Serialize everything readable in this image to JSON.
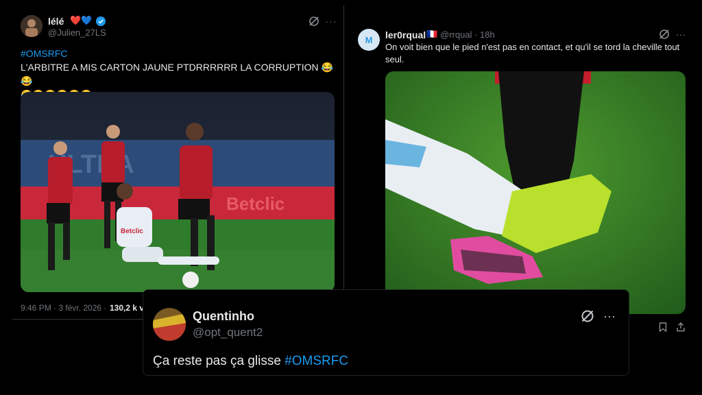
{
  "tweet1": {
    "name": "lélé",
    "handle": "@Julien_27LS",
    "hashtag": "#OMSRFC",
    "text_line1": "L'ARBITRE A MIS CARTON JAUNE PTDRRRRRR LA CORRUPTION 😂😂",
    "text_line2": "😂😂😂😂😂😂",
    "timestamp": "9:46 PM · 3 févr. 2026 ·",
    "views": "130,2 k v",
    "hearts": "❤️💙",
    "colors": {
      "accent": "#1d9bf0",
      "verified": "#1d9bf0"
    }
  },
  "tweet2": {
    "name": "ler0rqual",
    "flag": "🇫🇷",
    "handle": "@rrqual · 18h",
    "text": "On voit bien que le pied n'est pas en contact, et qu'il se tord la cheville tout seul."
  },
  "tweet3": {
    "name": "Quentinho",
    "handle": "@opt_quent2",
    "text": "Ça reste pas ça glisse",
    "hashtag": "#OMSRFC"
  },
  "icons": {
    "grok": "grok-icon",
    "more": "more-icon",
    "bookmark": "bookmark-icon",
    "share": "share-icon",
    "verified": "verified-badge-icon"
  }
}
